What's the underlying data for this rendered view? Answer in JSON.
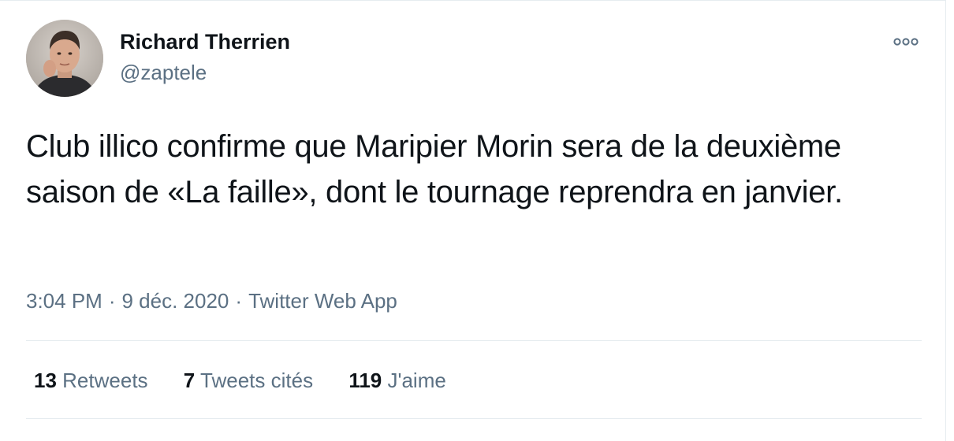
{
  "author": {
    "name": "Richard Therrien",
    "handle": "@zaptele",
    "avatar_icon": "profile-photo"
  },
  "menu": {
    "icon": "more-options-icon"
  },
  "tweet": {
    "text": "Club illico confirme que Maripier Morin sera de la deuxième saison de «La faille», dont le tournage reprendra en janvier."
  },
  "meta": {
    "time": "3:04 PM",
    "date": "9 déc. 2020",
    "source": "Twitter Web App",
    "separator": "·"
  },
  "stats": {
    "retweets": {
      "count": "13",
      "label": "Retweets"
    },
    "quotes": {
      "count": "7",
      "label": "Tweets cités"
    },
    "likes": {
      "count": "119",
      "label": "J'aime"
    }
  },
  "colors": {
    "primary_text": "#0f1419",
    "secondary_text": "#5b7083",
    "divider": "#e6ecf0",
    "background": "#ffffff"
  }
}
